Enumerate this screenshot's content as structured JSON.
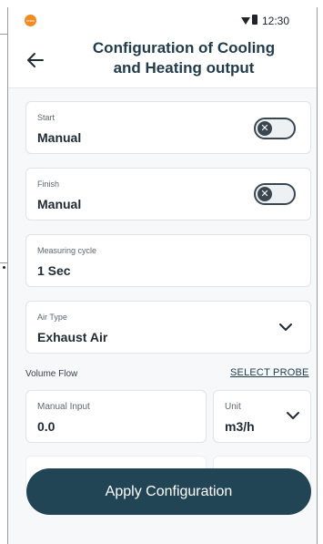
{
  "status_bar": {
    "logo_text": "testo",
    "time": "12:30"
  },
  "header": {
    "title_line1": "Configuration of Cooling",
    "title_line2": "and Heating output"
  },
  "fields": {
    "start": {
      "label": "Start",
      "value": "Manual"
    },
    "finish": {
      "label": "Finish",
      "value": "Manual"
    },
    "measuring_cycle": {
      "label": "Measuring cycle",
      "value": "1 Sec"
    },
    "air_type": {
      "label": "Air Type",
      "value": "Exhaust Air"
    }
  },
  "volume_flow": {
    "section_label": "Volume Flow",
    "select_probe": "SELECT PROBE",
    "manual_input": {
      "label": "Manual Input",
      "value": "0.0"
    },
    "unit": {
      "label": "Unit",
      "value": "m3/h"
    }
  },
  "actions": {
    "apply_label": "Apply Configuration"
  },
  "colors": {
    "primary": "#224555",
    "accent_logo": "#f08a22",
    "background": "#f6f8f9"
  },
  "icons": {
    "back": "arrow-left-icon",
    "toggle_off": "close-icon",
    "dropdown": "chevron-down-icon"
  }
}
